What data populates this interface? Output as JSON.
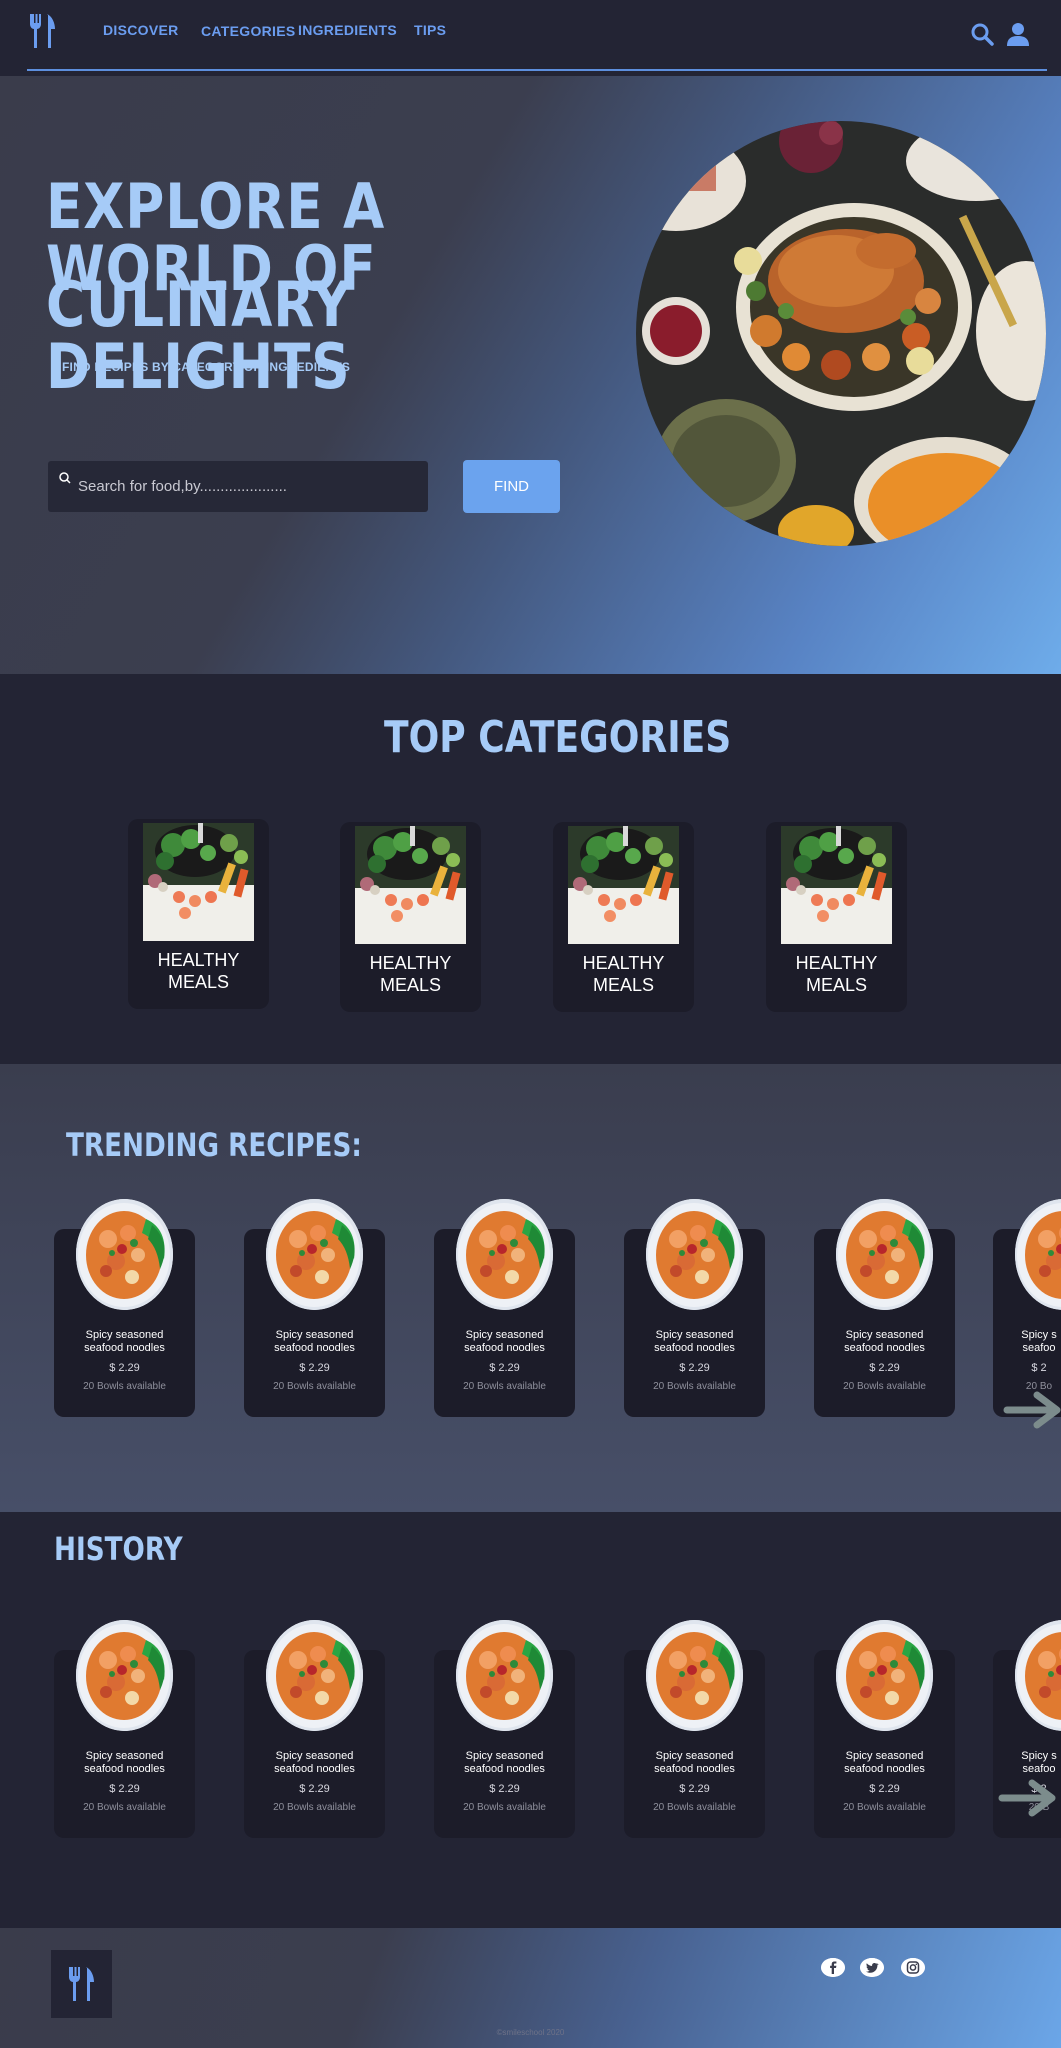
{
  "nav": {
    "links": [
      "DISCOVER",
      "CATEGORIES",
      "INGREDIENTS",
      "TIPS"
    ]
  },
  "hero": {
    "title_line1": "EXPLORE A WORLD OF",
    "title_line2": "CULINARY DELIGHTS",
    "subtitle": "FIND RECIPES BY CATEGORY OR INGREDIENTS",
    "search_placeholder": "Search for food,by.....................",
    "find_label": "FIND"
  },
  "categories": {
    "title": "TOP CATEGORIES",
    "items": [
      {
        "line1": "HEALTHY",
        "line2": "MEALS"
      },
      {
        "line1": "HEALTHY",
        "line2": "MEALS"
      },
      {
        "line1": "HEALTHY",
        "line2": "MEALS"
      },
      {
        "line1": "HEALTHY",
        "line2": "MEALS"
      }
    ]
  },
  "trending": {
    "title": "TRENDING RECIPES:",
    "items": [
      {
        "name1": "Spicy seasoned",
        "name2": "seafood noodles",
        "price": "$ 2.29",
        "availability": "20 Bowls available"
      },
      {
        "name1": "Spicy seasoned",
        "name2": "seafood noodles",
        "price": "$ 2.29",
        "availability": "20 Bowls available"
      },
      {
        "name1": "Spicy seasoned",
        "name2": "seafood noodles",
        "price": "$ 2.29",
        "availability": "20 Bowls available"
      },
      {
        "name1": "Spicy seasoned",
        "name2": "seafood noodles",
        "price": "$ 2.29",
        "availability": "20 Bowls available"
      },
      {
        "name1": "Spicy seasoned",
        "name2": "seafood noodles",
        "price": "$ 2.29",
        "availability": "20 Bowls available"
      },
      {
        "name1": "Spicy s",
        "name2": "seafoo",
        "price": "$ 2",
        "availability": "20 Bo"
      }
    ]
  },
  "history": {
    "title": "HISTORY",
    "items": [
      {
        "name1": "Spicy seasoned",
        "name2": "seafood noodles",
        "price": "$ 2.29",
        "availability": "20 Bowls available"
      },
      {
        "name1": "Spicy seasoned",
        "name2": "seafood noodles",
        "price": "$ 2.29",
        "availability": "20 Bowls available"
      },
      {
        "name1": "Spicy seasoned",
        "name2": "seafood noodles",
        "price": "$ 2.29",
        "availability": "20 Bowls available"
      },
      {
        "name1": "Spicy seasoned",
        "name2": "seafood noodles",
        "price": "$ 2.29",
        "availability": "20 Bowls available"
      },
      {
        "name1": "Spicy seasoned",
        "name2": "seafood noodles",
        "price": "$ 2.29",
        "availability": "20 Bowls available"
      },
      {
        "name1": "Spicy s",
        "name2": "seafoo",
        "price": "$ 2",
        "availability": "20 B"
      }
    ]
  },
  "footer": {
    "copyright": "©smileschool 2020",
    "socials": [
      "facebook-icon",
      "twitter-icon",
      "instagram-icon"
    ]
  },
  "colors": {
    "accent": "#6b9df0",
    "title": "#a6cbf7",
    "dark_bg": "#232434",
    "card_bg": "#1c1c29"
  }
}
